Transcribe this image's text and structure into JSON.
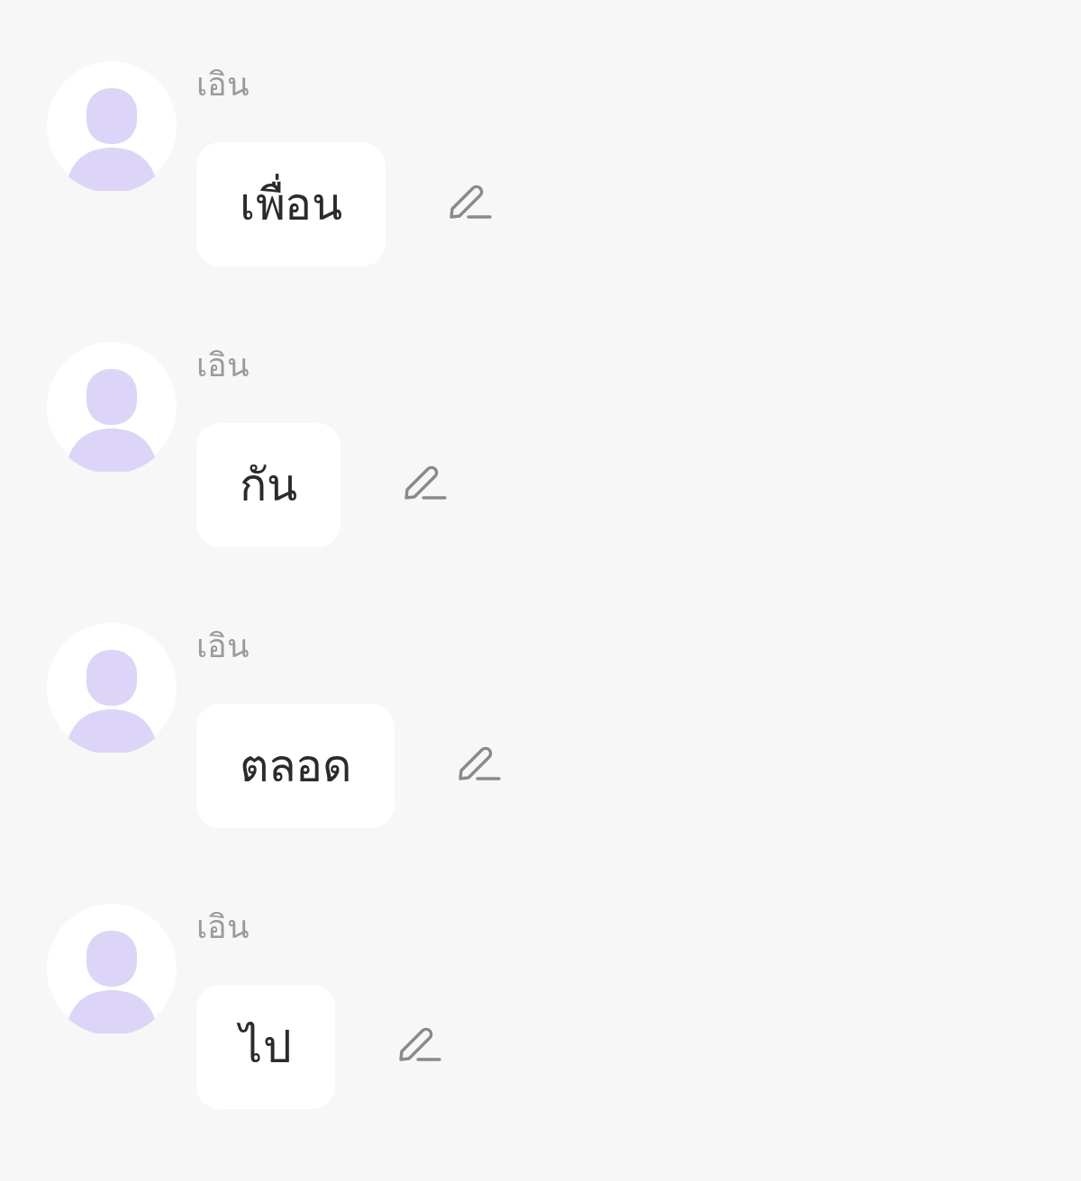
{
  "messages": [
    {
      "sender": "เอิน",
      "text": "เพื่อน"
    },
    {
      "sender": "เอิน",
      "text": "กัน"
    },
    {
      "sender": "เอิน",
      "text": "ตลอด"
    },
    {
      "sender": "เอิน",
      "text": "ไป"
    }
  ]
}
